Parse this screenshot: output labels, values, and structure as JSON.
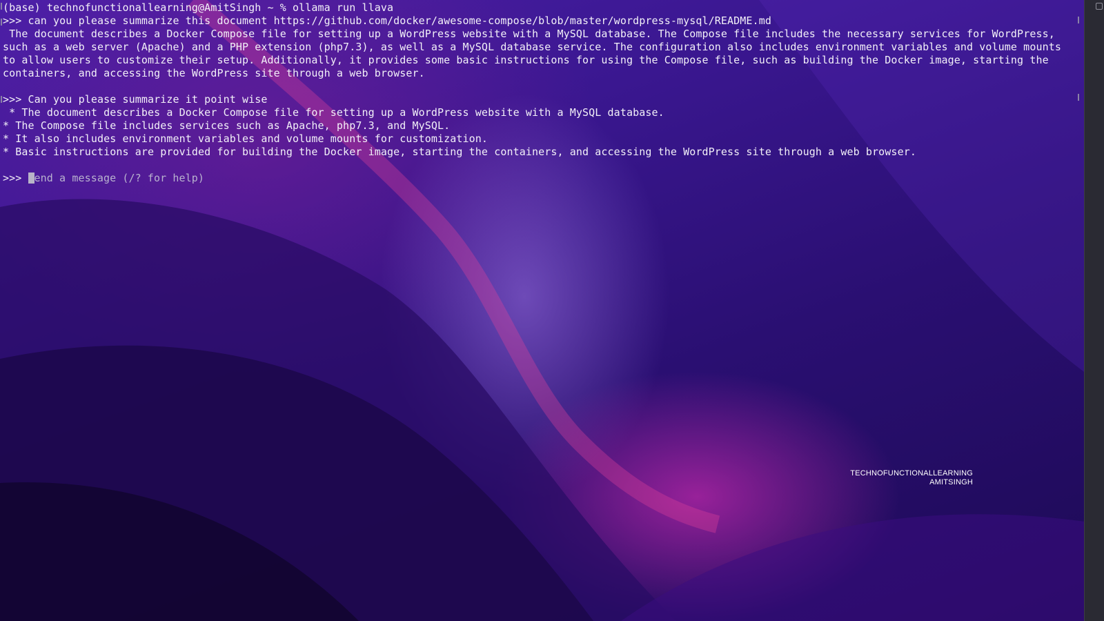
{
  "terminal": {
    "lines": {
      "l0": "(base) technofunctionallearning@AmitSingh ~ % ollama run llava",
      "l1": ">>> can you please summarize this document https://github.com/docker/awesome-compose/blob/master/wordpress-mysql/README.md",
      "l2": " The document describes a Docker Compose file for setting up a WordPress website with a MySQL database. The Compose file includes the necessary services for WordPress, such as a web server (Apache) and a PHP extension (php7.3), as well as a MySQL database service. The configuration also includes environment variables and volume mounts to allow users to customize their setup. Additionally, it provides some basic instructions for using the Compose file, such as building the Docker image, starting the containers, and accessing the WordPress site through a web browser.",
      "l3": ">>> Can you please summarize it point wise",
      "l4": " * The document describes a Docker Compose file for setting up a WordPress website with a MySQL database.",
      "l5": "* The Compose file includes services such as Apache, php7.3, and MySQL.",
      "l6": "* It also includes environment variables and volume mounts for customization.",
      "l7": "* Basic instructions are provided for building the Docker image, starting the containers, and accessing the WordPress site through a web browser."
    },
    "prompt": ">>> ",
    "placeholder": "end a message (/? for help)"
  },
  "watermark": {
    "line1": "TECHNOFUNCTIONALLEARNING",
    "line2": "AMITSINGH"
  },
  "colors": {
    "text": "#f2f0f8",
    "wallpaper_primary": "#3a1790",
    "wallpaper_accent": "#be28aa"
  }
}
